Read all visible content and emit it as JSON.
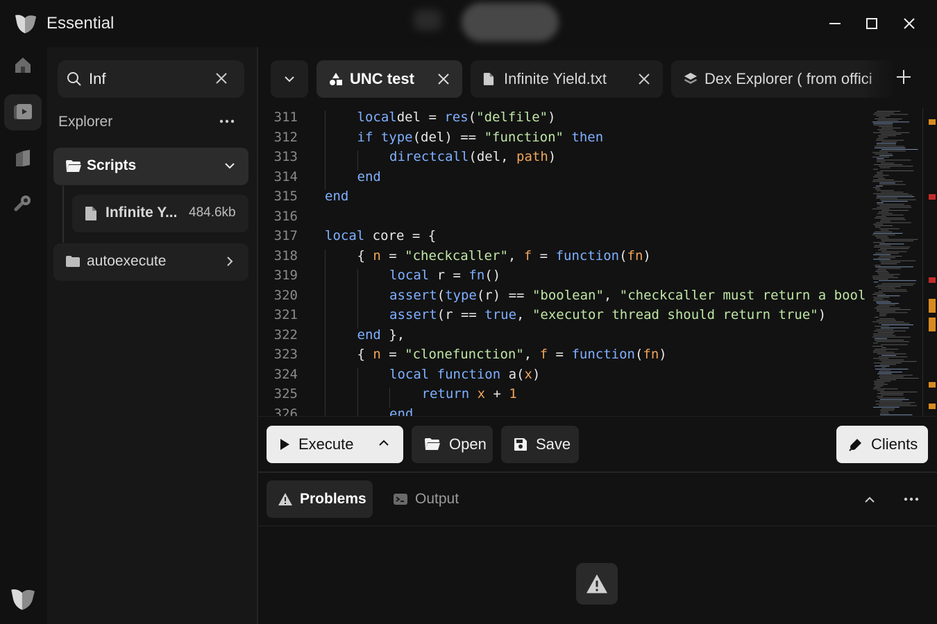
{
  "app": {
    "title": "Essential"
  },
  "colors": {
    "accent_keyword": "#7fb0ff",
    "string": "#bfe6a5",
    "number": "#f0a55b",
    "marker_orange": "#d98a1f",
    "marker_red": "#c42a2a"
  },
  "rail": {
    "items": [
      "home-icon",
      "editor-icon",
      "library-icon",
      "tools-icon"
    ],
    "active": 1
  },
  "search": {
    "value": "Inf"
  },
  "explorer": {
    "label": "Explorer",
    "folders": [
      {
        "label": "Scripts",
        "expanded": true,
        "files": [
          {
            "label": "Infinite Y...",
            "size": "484.6kb"
          }
        ]
      },
      {
        "label": "autoexecute",
        "expanded": false
      }
    ]
  },
  "tabs": [
    {
      "label": "UNC test",
      "icon": "shapes-icon",
      "active": true
    },
    {
      "label": "Infinite Yield.txt",
      "icon": "file-icon",
      "active": false
    },
    {
      "label": "Dex Explorer ( from offici",
      "icon": "layers-icon",
      "active": false
    }
  ],
  "editor": {
    "lines": [
      {
        "n": "311",
        "indent": 1,
        "tokens": [
          [
            "kw",
            "local"
          ],
          [
            "",
            "del = "
          ],
          [
            "fn",
            "res"
          ],
          [
            "",
            "("
          ],
          [
            "st",
            "\"delfile\""
          ],
          [
            "",
            ")"
          ]
        ]
      },
      {
        "n": "312",
        "indent": 1,
        "tokens": [
          [
            "kw",
            "if"
          ],
          [
            "",
            " "
          ],
          [
            "fn",
            "type"
          ],
          [
            "",
            "(del) == "
          ],
          [
            "st",
            "\"function\""
          ],
          [
            "",
            " "
          ],
          [
            "kw",
            "then"
          ]
        ]
      },
      {
        "n": "313",
        "indent": 2,
        "tokens": [
          [
            "fn",
            "directcall"
          ],
          [
            "",
            "(del, "
          ],
          [
            "vr",
            "path"
          ],
          [
            "",
            ")"
          ]
        ]
      },
      {
        "n": "314",
        "indent": 1,
        "tokens": [
          [
            "kw",
            "end"
          ]
        ]
      },
      {
        "n": "315",
        "indent": 0,
        "tokens": [
          [
            "kw",
            "end"
          ]
        ]
      },
      {
        "n": "316",
        "indent": 0,
        "tokens": []
      },
      {
        "n": "317",
        "indent": 0,
        "tokens": [
          [
            "kw",
            "local"
          ],
          [
            "",
            " core = {"
          ]
        ]
      },
      {
        "n": "318",
        "indent": 1,
        "tokens": [
          [
            "",
            "{ "
          ],
          [
            "vr",
            "n"
          ],
          [
            "",
            " = "
          ],
          [
            "st",
            "\"checkcaller\""
          ],
          [
            "",
            ", "
          ],
          [
            "vr",
            "f"
          ],
          [
            "",
            " = "
          ],
          [
            "kw",
            "function"
          ],
          [
            "",
            "("
          ],
          [
            "vr",
            "fn"
          ],
          [
            "",
            ")"
          ]
        ]
      },
      {
        "n": "319",
        "indent": 2,
        "tokens": [
          [
            "kw",
            "local"
          ],
          [
            "",
            " r = "
          ],
          [
            "fn",
            "fn"
          ],
          [
            "",
            "()"
          ]
        ]
      },
      {
        "n": "320",
        "indent": 2,
        "tokens": [
          [
            "fn",
            "assert"
          ],
          [
            "",
            "("
          ],
          [
            "fn",
            "type"
          ],
          [
            "",
            "(r) == "
          ],
          [
            "st",
            "\"boolean\""
          ],
          [
            "",
            ", "
          ],
          [
            "st",
            "\"checkcaller must return a bool"
          ]
        ]
      },
      {
        "n": "321",
        "indent": 2,
        "tokens": [
          [
            "fn",
            "assert"
          ],
          [
            "",
            "(r == "
          ],
          [
            "kw",
            "true"
          ],
          [
            "",
            ", "
          ],
          [
            "st",
            "\"executor thread should return true\""
          ],
          [
            "",
            ")"
          ]
        ]
      },
      {
        "n": "322",
        "indent": 1,
        "tokens": [
          [
            "kw",
            "end"
          ],
          [
            "",
            " },"
          ]
        ]
      },
      {
        "n": "323",
        "indent": 1,
        "tokens": [
          [
            "",
            "{ "
          ],
          [
            "vr",
            "n"
          ],
          [
            "",
            " = "
          ],
          [
            "st",
            "\"clonefunction\""
          ],
          [
            "",
            ", "
          ],
          [
            "vr",
            "f"
          ],
          [
            "",
            " = "
          ],
          [
            "kw",
            "function"
          ],
          [
            "",
            "("
          ],
          [
            "vr",
            "fn"
          ],
          [
            "",
            ")"
          ]
        ]
      },
      {
        "n": "324",
        "indent": 2,
        "tokens": [
          [
            "kw",
            "local"
          ],
          [
            "",
            " "
          ],
          [
            "kw",
            "function"
          ],
          [
            "",
            " a("
          ],
          [
            "vr",
            "x"
          ],
          [
            "",
            ")"
          ]
        ]
      },
      {
        "n": "325",
        "indent": 3,
        "tokens": [
          [
            "kw",
            "return"
          ],
          [
            "",
            " "
          ],
          [
            "vr",
            "x"
          ],
          [
            "",
            " + "
          ],
          [
            "nm",
            "1"
          ]
        ]
      },
      {
        "n": "326",
        "indent": 2,
        "tokens": [
          [
            "kw",
            "end"
          ]
        ]
      }
    ],
    "scroll_markers": [
      {
        "pos": 0.035,
        "color": "marker_orange"
      },
      {
        "pos": 0.28,
        "color": "marker_red"
      },
      {
        "pos": 0.55,
        "color": "marker_red"
      },
      {
        "pos": 0.62,
        "color": "marker_orange"
      },
      {
        "pos": 0.68,
        "color": "marker_orange"
      },
      {
        "pos": 0.89,
        "color": "marker_orange"
      },
      {
        "pos": 0.96,
        "color": "marker_orange"
      }
    ]
  },
  "actions": {
    "execute": "Execute",
    "open": "Open",
    "save": "Save",
    "clients": "Clients"
  },
  "panel": {
    "tabs": [
      {
        "label": "Problems",
        "active": true
      },
      {
        "label": "Output",
        "active": false
      }
    ]
  }
}
